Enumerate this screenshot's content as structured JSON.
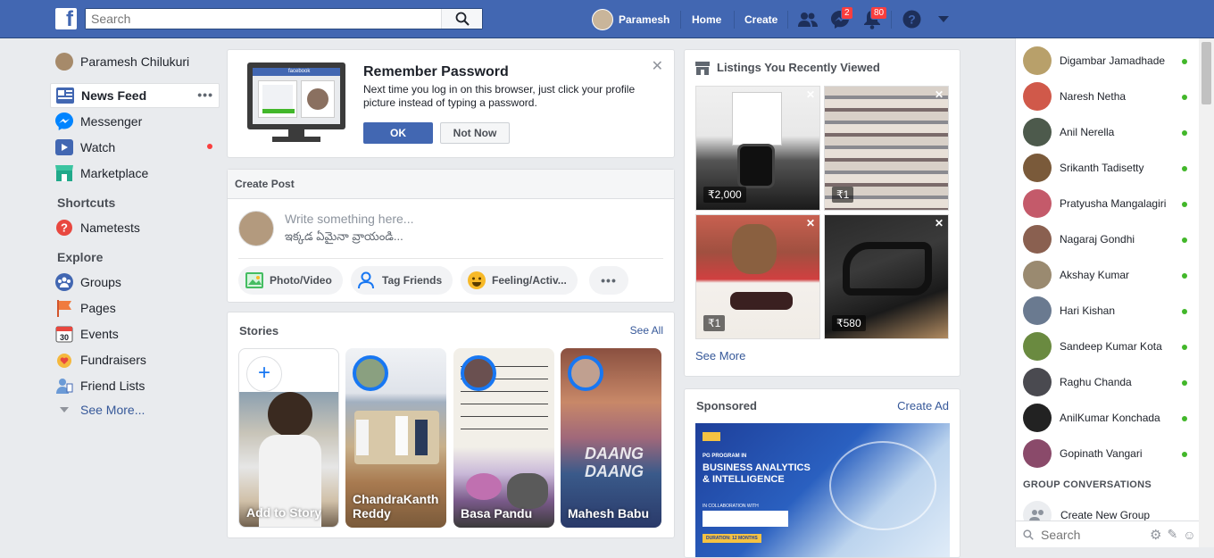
{
  "header": {
    "search_placeholder": "Search",
    "profile_name": "Paramesh",
    "home": "Home",
    "create": "Create",
    "messenger_badge": "2",
    "notif_badge": "80"
  },
  "left_nav": {
    "profile": "Paramesh Chilukuri",
    "items": [
      {
        "label": "News Feed"
      },
      {
        "label": "Messenger"
      },
      {
        "label": "Watch"
      },
      {
        "label": "Marketplace"
      }
    ],
    "shortcuts_heading": "Shortcuts",
    "shortcuts": [
      {
        "label": "Nametests"
      }
    ],
    "explore_heading": "Explore",
    "explore": [
      {
        "label": "Groups"
      },
      {
        "label": "Pages"
      },
      {
        "label": "Events"
      },
      {
        "label": "Fundraisers"
      },
      {
        "label": "Friend Lists"
      }
    ],
    "see_more": "See More...",
    "events_day": "30"
  },
  "remember": {
    "title": "Remember Password",
    "body": "Next time you log in on this browser, just click your profile picture instead of typing a password.",
    "ok": "OK",
    "not_now": "Not Now",
    "mock_brand": "facebook"
  },
  "create_post": {
    "title": "Create Post",
    "placeholder": "Write something here...",
    "placeholder_te": "ఇక్కడ ఏమైనా వ్రాయండి...",
    "actions": [
      "Photo/Video",
      "Tag Friends",
      "Feeling/Activ..."
    ]
  },
  "stories": {
    "title": "Stories",
    "see_all": "See All",
    "items": [
      {
        "name": "Add to Story"
      },
      {
        "name": "ChandraKanth Reddy"
      },
      {
        "name": "Basa Pandu"
      },
      {
        "name": "Mahesh Babu"
      }
    ]
  },
  "listings": {
    "title": "Listings You Recently Viewed",
    "prices": [
      "₹2,000",
      "₹1",
      "₹1",
      "₹580"
    ],
    "see_more": "See More"
  },
  "sponsored": {
    "title": "Sponsored",
    "create_ad": "Create Ad",
    "ad_line1": "PG PROGRAM IN",
    "ad_line2": "BUSINESS ANALYTICS",
    "ad_line3": "& INTELLIGENCE",
    "ad_line4": "IN COLLABORATION WITH",
    "ad_line5": "DURATION: 12 MONTHS"
  },
  "contacts": {
    "items": [
      {
        "name": "Digambar Jamadhade",
        "color": "#b8a06a"
      },
      {
        "name": "Naresh Netha",
        "color": "#d0594a"
      },
      {
        "name": "Anil Nerella",
        "color": "#4d5a4c"
      },
      {
        "name": "Srikanth Tadisetty",
        "color": "#7a5a3a"
      },
      {
        "name": "Pratyusha Mangalagiri",
        "color": "#c45a6a"
      },
      {
        "name": "Nagaraj Gondhi",
        "color": "#8a6050"
      },
      {
        "name": "Akshay Kumar",
        "color": "#9a8a70"
      },
      {
        "name": "Hari Kishan",
        "color": "#6a7a90"
      },
      {
        "name": "Sandeep Kumar Kota",
        "color": "#6a8a40"
      },
      {
        "name": "Raghu Chanda",
        "color": "#4a4a50"
      },
      {
        "name": "AnilKumar Konchada",
        "color": "#222222"
      },
      {
        "name": "Gopinath Vangari",
        "color": "#8a4a6a"
      }
    ],
    "group_heading": "GROUP CONVERSATIONS",
    "create_group": "Create New Group",
    "search_placeholder": "Search"
  },
  "colors": {
    "brand": "#4267b2",
    "online": "#42b72a",
    "badge": "#fa3e3e"
  }
}
